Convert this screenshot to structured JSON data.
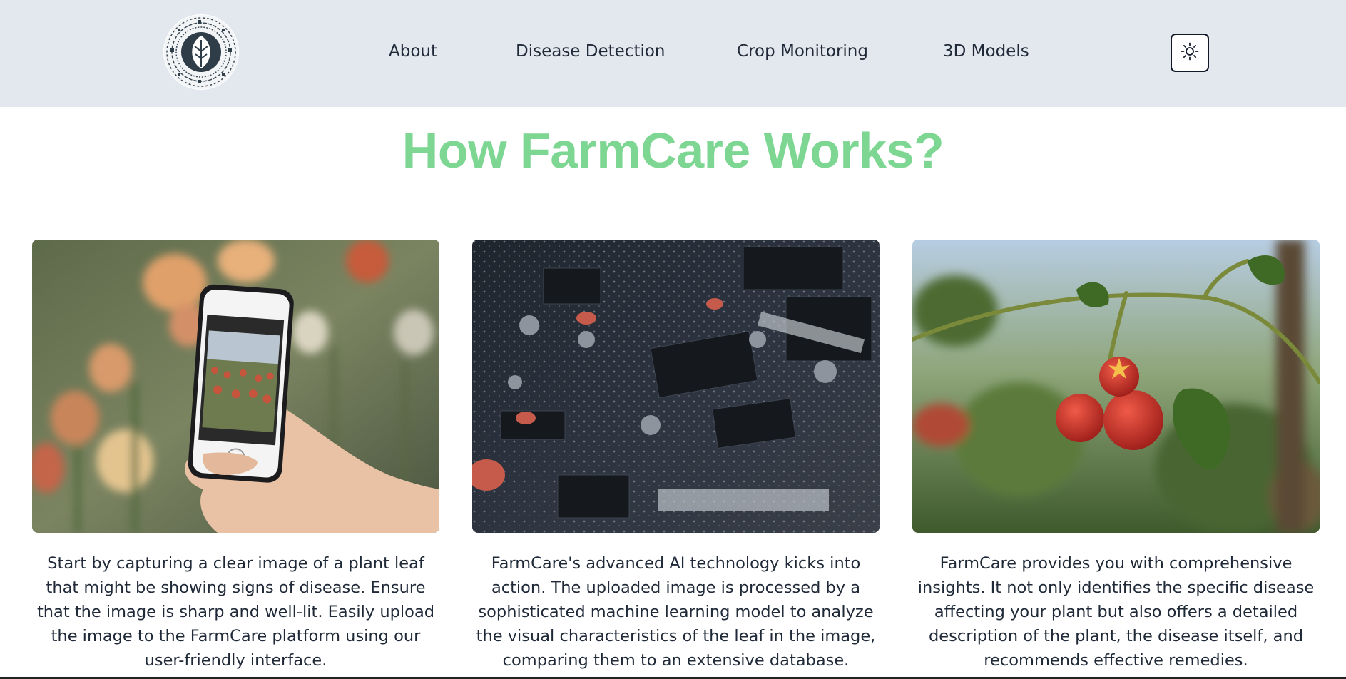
{
  "nav": {
    "logo_icon": "leaf-tech-circle-logo",
    "links": [
      {
        "label": "About"
      },
      {
        "label": "Disease Detection"
      },
      {
        "label": "Crop Monitoring"
      },
      {
        "label": "3D Models"
      }
    ],
    "theme_toggle_icon": "sun-icon"
  },
  "main": {
    "title": "How FarmCare Works?",
    "cards": [
      {
        "image_icon": "phone-photographing-flowers-image",
        "text": "Start by capturing a clear image of a plant leaf that might be showing signs of disease. Ensure that the image is sharp and well-lit. Easily upload the image to the FarmCare platform using our user-friendly interface."
      },
      {
        "image_icon": "circuit-board-image",
        "text": "FarmCare's advanced AI technology kicks into action. The uploaded image is processed by a sophisticated machine learning model to analyze the visual characteristics of the leaf in the image, comparing them to an extensive database."
      },
      {
        "image_icon": "tomato-plant-image",
        "text": "FarmCare provides you with comprehensive insights. It not only identifies the specific disease affecting your plant but also offers a detailed description of the plant, the disease itself, and recommends effective remedies."
      }
    ]
  },
  "colors": {
    "navbar_bg": "#e3e8ee",
    "title_green": "#7dd691",
    "text": "#1f2937"
  }
}
